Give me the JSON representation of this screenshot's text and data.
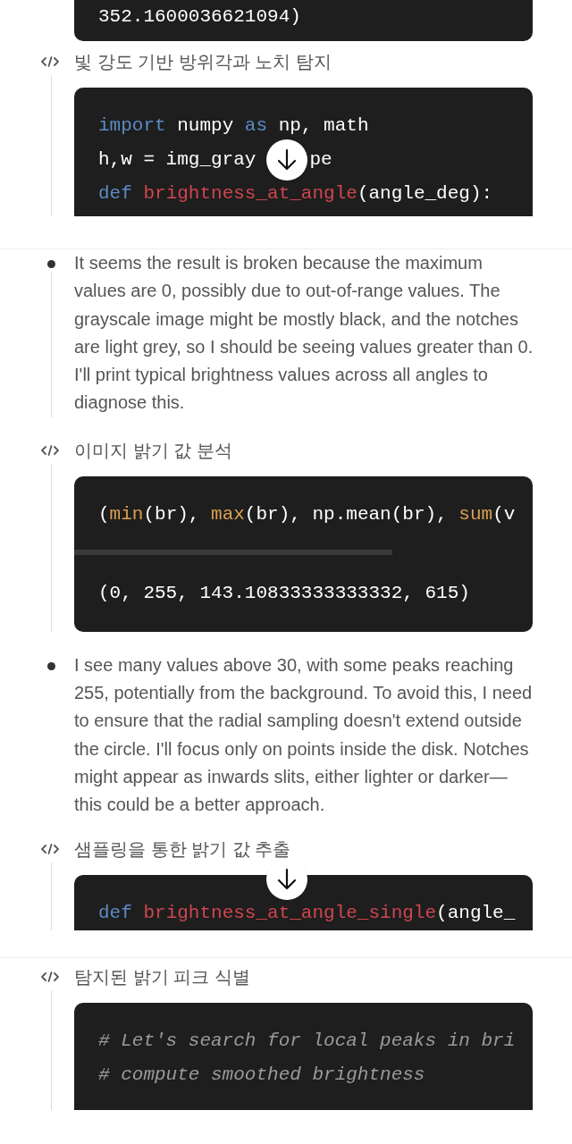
{
  "items": [
    {
      "kind": "code",
      "lines": [
        [
          {
            "t": "352.1600036621094)",
            "kind": "plain"
          }
        ]
      ]
    },
    {
      "kind": "step",
      "title": "빛 강도 기반 방위각과 노치 탐지",
      "code": {
        "scroll_button": true,
        "lines": [
          [
            {
              "t": "import",
              "kind": "keyword"
            },
            {
              "t": " numpy ",
              "kind": "plain"
            },
            {
              "t": "as",
              "kind": "keyword"
            },
            {
              "t": " np, math",
              "kind": "plain"
            }
          ],
          [
            {
              "t": "h,w = img_gray",
              "kind": "plain"
            },
            {
              "t": "pe",
              "kind": "after_gap"
            }
          ],
          [
            {
              "t": "def ",
              "kind": "keyword"
            },
            {
              "t": "brightness_at_angle",
              "kind": "function"
            },
            {
              "t": "(angle_deg):",
              "kind": "plain"
            }
          ]
        ]
      }
    },
    {
      "kind": "bullet",
      "text": "It seems the result is broken because the maximum values are 0, possibly due to out-of-range values. The grayscale image might be mostly black, and the notches are light grey, so I should be seeing values greater than 0. I'll print typical brightness values across all angles to diagnose this."
    },
    {
      "kind": "step",
      "title": "이미지 밝기 값 분석",
      "code": {
        "lines": [
          [
            {
              "t": "(",
              "kind": "plain"
            },
            {
              "t": "min",
              "kind": "builtin"
            },
            {
              "t": "(br), ",
              "kind": "plain"
            },
            {
              "t": "max",
              "kind": "builtin"
            },
            {
              "t": "(br), np.mean(br), ",
              "kind": "plain"
            },
            {
              "t": "sum",
              "kind": "builtin"
            },
            {
              "t": "(v",
              "kind": "plain"
            }
          ]
        ],
        "output": [
          "(0, 255, 143.10833333333332, 615)"
        ]
      }
    },
    {
      "kind": "bullet",
      "text": "I see many values above 30, with some peaks reaching 255, potentially from the background. To avoid this, I need to ensure that the radial sampling doesn't extend outside the circle. I'll focus only on points inside the disk. Notches might appear as inwards slits, either lighter or darker—this could be a better approach."
    },
    {
      "kind": "step",
      "title": "샘플링을 통한 밝기 값 추출",
      "code": {
        "scroll_button": true,
        "lines": [
          [
            {
              "t": "def ",
              "kind": "keyword"
            },
            {
              "t": "brightness_at_angle_single",
              "kind": "function"
            },
            {
              "t": "(angle_",
              "kind": "plain"
            }
          ]
        ]
      }
    },
    {
      "kind": "step",
      "title": "탐지된 밝기 피크 식별",
      "code": {
        "lines": [
          [
            {
              "t": "# Let's search for local peaks in bri",
              "kind": "comment"
            }
          ],
          [
            {
              "t": "# compute smoothed brightness",
              "kind": "comment"
            }
          ]
        ]
      }
    }
  ]
}
